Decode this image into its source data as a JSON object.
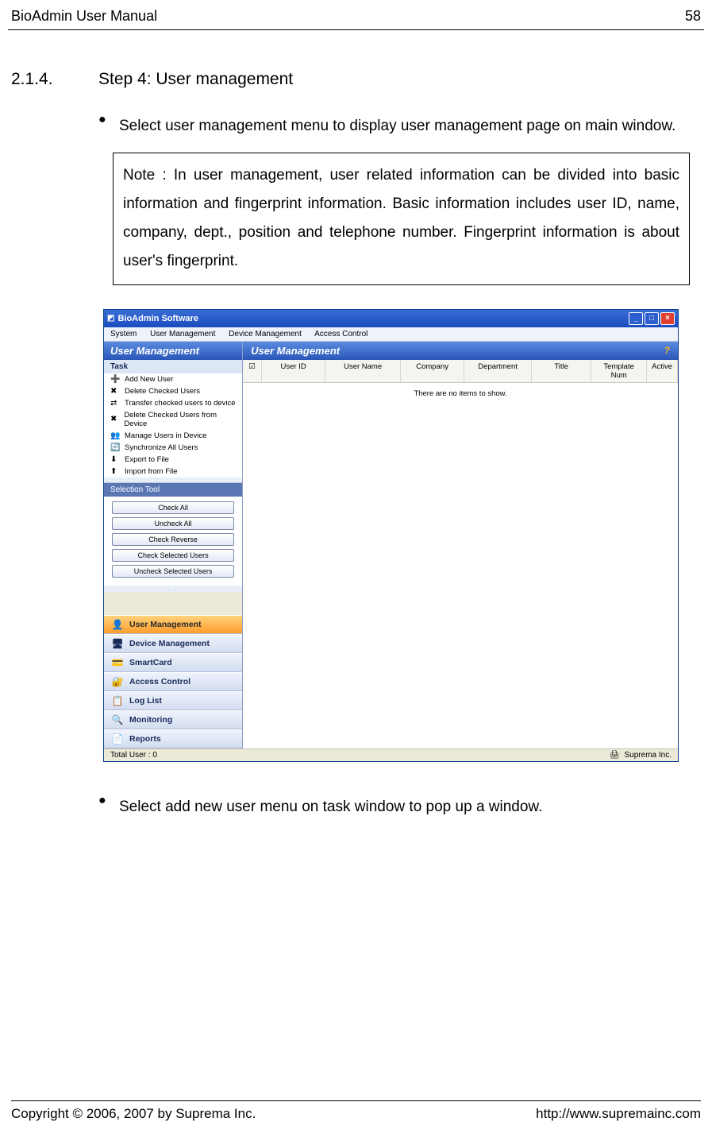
{
  "header": {
    "left": "BioAdmin User Manual",
    "page": "58"
  },
  "section": {
    "number": "2.1.4.",
    "title": "Step 4: User management"
  },
  "bullets": [
    "Select user management menu to display user management page on main window.",
    "Select add new user menu on task window to pop up a window."
  ],
  "note": "Note : In user management, user related information can be divided into basic information and fingerprint information. Basic information includes user ID, name, company, dept., position and telephone number. Fingerprint information is about user's fingerprint.",
  "app": {
    "title": "BioAdmin Software",
    "menubar": [
      "System",
      "User Management",
      "Device Management",
      "Access Control"
    ],
    "left_pane_title": "User Management",
    "task_header": "Task",
    "tasks": [
      {
        "icon": "➕",
        "label": "Add New User"
      },
      {
        "icon": "✖",
        "label": "Delete Checked Users"
      },
      {
        "icon": "⇄",
        "label": "Transfer checked users to device"
      },
      {
        "icon": "✖",
        "label": "Delete Checked Users from Device"
      },
      {
        "icon": "👥",
        "label": "Manage Users in Device"
      },
      {
        "icon": "🔄",
        "label": "Synchronize All Users"
      },
      {
        "icon": "⬇",
        "label": "Export to File"
      },
      {
        "icon": "⬆",
        "label": "Import from File"
      }
    ],
    "selection_header": "Selection Tool",
    "selection_buttons": [
      "Check All",
      "Uncheck All",
      "Check Reverse",
      "Check Selected Users",
      "Uncheck Selected Users"
    ],
    "nav": [
      {
        "icon": "👤",
        "label": "User Management",
        "active": true
      },
      {
        "icon": "🖥",
        "label": "Device Management",
        "active": false
      },
      {
        "icon": "💳",
        "label": "SmartCard",
        "active": false
      },
      {
        "icon": "🔐",
        "label": "Access Control",
        "active": false
      },
      {
        "icon": "📋",
        "label": "Log List",
        "active": false
      },
      {
        "icon": "🔍",
        "label": "Monitoring",
        "active": false
      },
      {
        "icon": "📄",
        "label": "Reports",
        "active": false
      }
    ],
    "right_pane_title": "User Management",
    "columns": [
      "",
      "User ID",
      "User Name",
      "Company",
      "Department",
      "Title",
      "Template Num",
      "Active"
    ],
    "no_items_text": "There are no items to show.",
    "status_left": "Total User : 0",
    "status_right": "Suprema Inc."
  },
  "footer": {
    "left": "Copyright © 2006, 2007 by Suprema Inc.",
    "right": "http://www.supremainc.com"
  }
}
